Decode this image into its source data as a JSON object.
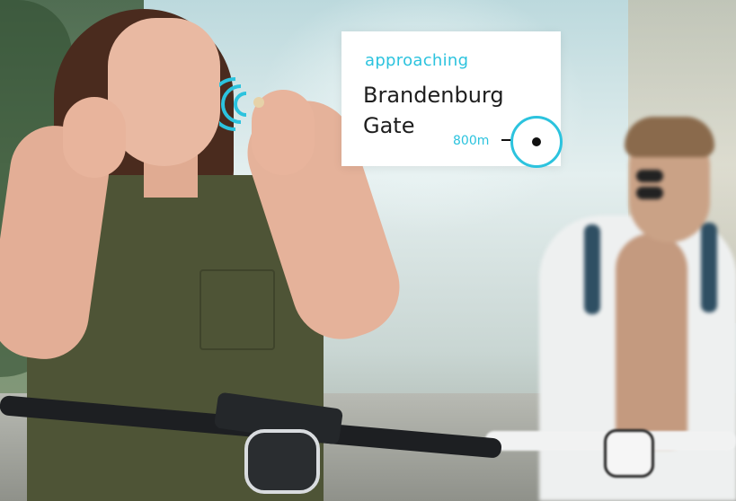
{
  "notification": {
    "subtitle": "approaching",
    "title_line1": "Brandenburg",
    "title_line2": "Gate",
    "distance": "800m"
  },
  "colors": {
    "accent": "#2cc3de",
    "text": "#1e1e1e",
    "card_bg": "#ffffff"
  },
  "icons": {
    "earbud_signal": "audio-waves-icon",
    "direction": "arrow-right-icon",
    "destination": "target-icon"
  }
}
